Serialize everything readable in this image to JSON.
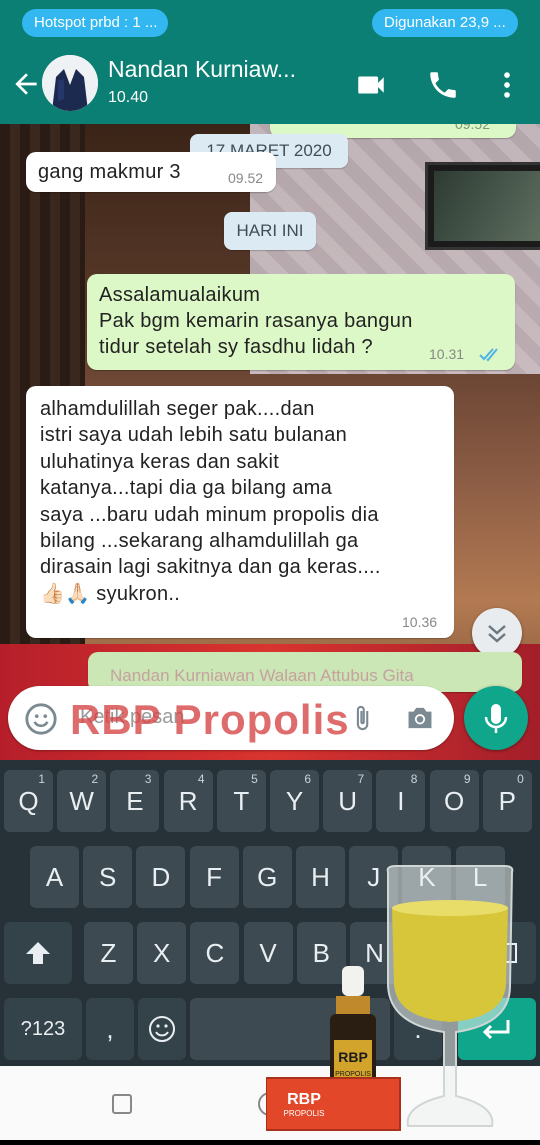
{
  "status_bar": {
    "left_pill": "Hotspot prbd : 1 ...",
    "right_pill": "Digunakan 23,9 ..."
  },
  "header": {
    "contact_name": "Nandan Kurniaw...",
    "subtitle": "10.40",
    "icons": [
      "back-arrow-icon",
      "video-call-icon",
      "phone-icon",
      "more-vert-icon"
    ]
  },
  "chat": {
    "top_partial_time": "09.52",
    "date_chip_1": "17 MARET 2020",
    "msg_1": {
      "text": "gang makmur 3",
      "time": "09.52"
    },
    "date_chip_2": "HARI INI",
    "msg_2": {
      "line1": "Assalamualaikum",
      "line2": "Pak bgm kemarin rasanya bangun",
      "line3": "tidur setelah sy fasdhu lidah ?",
      "time": "10.31"
    },
    "msg_3": {
      "line1": "alhamdulillah seger pak....dan",
      "line2": "istri saya udah lebih satu bulanan",
      "line3": "uluhatinya keras dan sakit",
      "line4": "katanya...tapi dia ga bilang ama",
      "line5": "saya ...baru udah minum propolis dia",
      "line6": "bilang  ...sekarang alhamdulillah ga",
      "line7": "dirasain lagi sakitnya dan ga keras....",
      "line8_emoji": "👍🏻🙏🏻",
      "line8_text": "syukron..",
      "time": "10.36"
    },
    "partial_quote": "Nandan Kurniawan Walaan Attubus Gita"
  },
  "input": {
    "placeholder": "Ketik pesan",
    "watermark": "RBP Propolis"
  },
  "keyboard": {
    "row1": [
      {
        "k": "Q",
        "h": "1"
      },
      {
        "k": "W",
        "h": "2"
      },
      {
        "k": "E",
        "h": "3"
      },
      {
        "k": "R",
        "h": "4"
      },
      {
        "k": "T",
        "h": "5"
      },
      {
        "k": "Y",
        "h": "6"
      },
      {
        "k": "U",
        "h": "7"
      },
      {
        "k": "I",
        "h": "8"
      },
      {
        "k": "O",
        "h": "9"
      },
      {
        "k": "P",
        "h": "0"
      }
    ],
    "row2": [
      "A",
      "S",
      "D",
      "F",
      "G",
      "H",
      "J",
      "K",
      "L"
    ],
    "row3": [
      "Z",
      "X",
      "C",
      "V",
      "B",
      "N",
      "M"
    ],
    "sym_label": "?123",
    "comma": ",",
    "period": "."
  },
  "product": {
    "bottle_label": "RBP",
    "bottle_sub": "PROPOLIS",
    "box_label": "RBP",
    "box_sub": "PROPOLIS",
    "colors": {
      "box": "#e2472a",
      "liquid": "#d7c53a",
      "accent": "#0fa68c"
    }
  }
}
